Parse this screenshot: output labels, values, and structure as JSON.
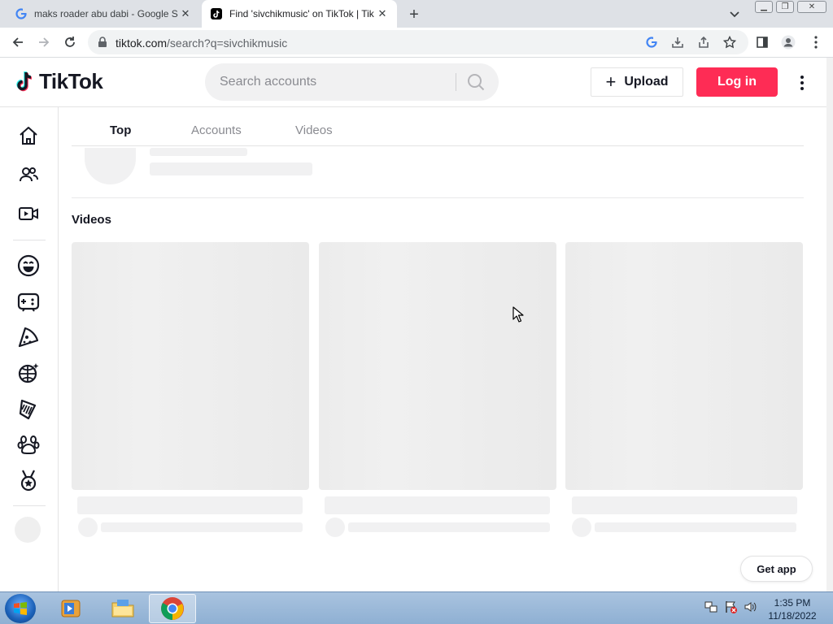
{
  "browser": {
    "tabs": [
      {
        "title": "maks roader abu dabi - Google S",
        "active": false
      },
      {
        "title": "Find 'sivchikmusic' on TikTok | Tik",
        "active": true
      }
    ],
    "url_host": "tiktok.com",
    "url_path": "/search?q=sivchikmusic"
  },
  "header": {
    "logo_text": "TikTok",
    "search_placeholder": "Search accounts",
    "upload_label": "Upload",
    "login_label": "Log in"
  },
  "content": {
    "tabs": [
      {
        "label": "Top",
        "active": true
      },
      {
        "label": "Accounts",
        "active": false
      },
      {
        "label": "Videos",
        "active": false
      }
    ],
    "section_title": "Videos",
    "get_app_label": "Get app"
  },
  "sidebar": {
    "items": [
      "home-icon",
      "following-icon",
      "live-icon",
      "comedy-icon",
      "gaming-icon",
      "food-icon",
      "dance-icon",
      "beauty-icon",
      "animals-icon",
      "sports-icon"
    ]
  },
  "taskbar": {
    "time": "1:35 PM",
    "date": "11/18/2022"
  },
  "colors": {
    "brand": "#fe2c55",
    "text": "#161823",
    "skeleton": "#f1f1f2"
  }
}
